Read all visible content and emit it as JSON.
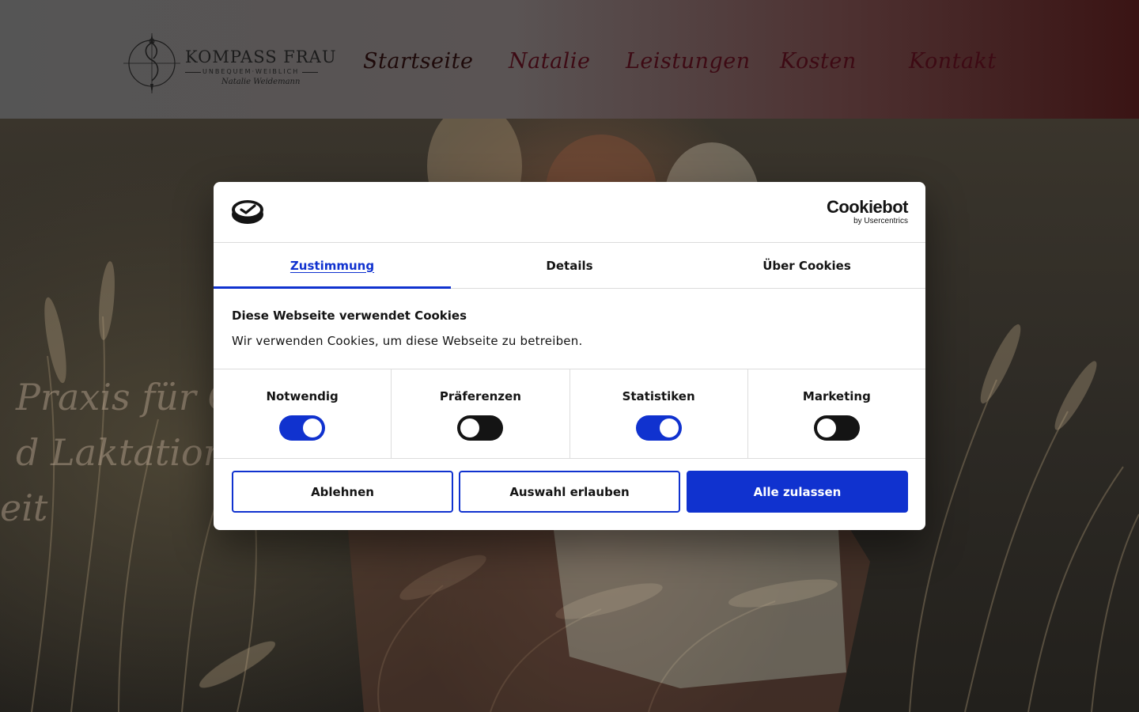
{
  "site": {
    "logo": {
      "title": "KOMPASS FRAU",
      "subtitle": "UNBEQUEM·WEIBLICH",
      "signature": "Natalie Weidemann"
    },
    "nav": [
      {
        "label": "Startseite",
        "active": true
      },
      {
        "label": "Natalie"
      },
      {
        "label": "Leistungen"
      },
      {
        "label": "Kosten"
      },
      {
        "label": "Kontakt"
      }
    ],
    "hero": {
      "line1": "Praxis für Ge",
      "line2": "d Laktationsb",
      "line3": "eit"
    }
  },
  "cookie_dialog": {
    "brand": {
      "name": "Cookiebot",
      "by": "by Usercentrics"
    },
    "tabs": [
      {
        "label": "Zustimmung",
        "active": true
      },
      {
        "label": "Details"
      },
      {
        "label": "Über Cookies"
      }
    ],
    "title": "Diese Webseite verwendet Cookies",
    "text": "Wir verwenden Cookies, um diese Webseite zu betreiben.",
    "categories": [
      {
        "label": "Notwendig",
        "checked": true
      },
      {
        "label": "Präferenzen",
        "checked": false
      },
      {
        "label": "Statistiken",
        "checked": true
      },
      {
        "label": "Marketing",
        "checked": false
      }
    ],
    "buttons": {
      "reject": "Ablehnen",
      "allow_selection": "Auswahl erlauben",
      "allow_all": "Alle zulassen"
    },
    "colors": {
      "accent": "#1032cf",
      "toggle_off": "#141414"
    }
  }
}
